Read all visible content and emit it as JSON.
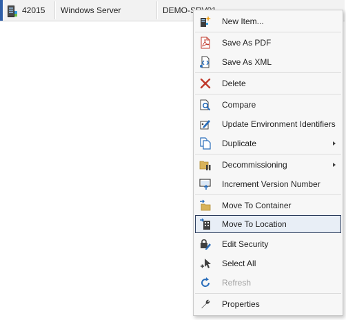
{
  "grid": {
    "row": {
      "id": "42015",
      "os": "Windows Server",
      "name": "DEMO-SRV01"
    }
  },
  "context_menu": {
    "items": {
      "new_item": {
        "label": "New Item...",
        "icon": "new-item-icon"
      },
      "save_pdf": {
        "label": "Save As PDF",
        "icon": "pdf-icon"
      },
      "save_xml": {
        "label": "Save As XML",
        "icon": "xml-icon"
      },
      "delete": {
        "label": "Delete",
        "icon": "delete-x-icon"
      },
      "compare": {
        "label": "Compare",
        "icon": "compare-icon"
      },
      "update_env": {
        "label": "Update Environment Identifiers",
        "icon": "update-identifiers-icon"
      },
      "duplicate": {
        "label": "Duplicate",
        "icon": "duplicate-icon",
        "has_submenu": true
      },
      "decommissioning": {
        "label": "Decommissioning",
        "icon": "decommissioning-icon",
        "has_submenu": true
      },
      "increment_version": {
        "label": "Increment Version Number",
        "icon": "increment-version-icon"
      },
      "move_container": {
        "label": "Move To Container",
        "icon": "move-container-icon"
      },
      "move_location": {
        "label": "Move To Location",
        "icon": "move-location-icon",
        "state": "hovered"
      },
      "edit_security": {
        "label": "Edit Security",
        "icon": "edit-security-icon"
      },
      "select_all": {
        "label": "Select All",
        "icon": "select-all-icon"
      },
      "refresh": {
        "label": "Refresh",
        "icon": "refresh-icon",
        "state": "disabled"
      },
      "properties": {
        "label": "Properties",
        "icon": "wrench-icon"
      }
    }
  },
  "colors": {
    "row_accent": "#2f5fa8",
    "menu_background": "#f7f7f7",
    "hover_background": "#e8eef6",
    "hover_border": "#2b3c5c",
    "delete_red": "#c0392b",
    "icon_blue": "#2a6ebb",
    "folder_tan": "#d8b35a",
    "disabled_text": "#a0a0a0"
  }
}
